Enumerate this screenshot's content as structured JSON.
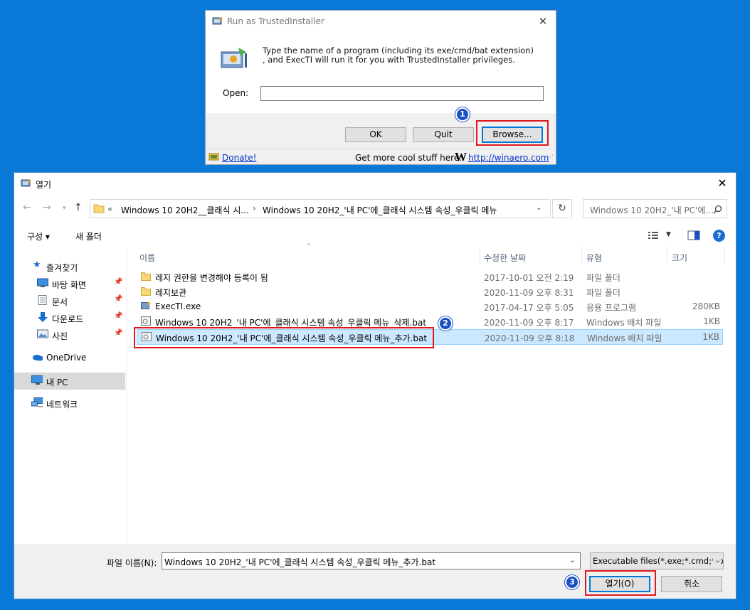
{
  "trusted_dialog": {
    "title": "Run as TrustedInstaller",
    "description_line1": "Type the name of a program (including its exe/cmd/bat extension)",
    "description_line2": ", and ExecTI will run it for you with TrustedInstaller privileges.",
    "open_label": "Open:",
    "open_value": "",
    "ok_label": "OK",
    "quit_label": "Quit",
    "browse_label": "Browse...",
    "donate_label": "Donate!",
    "more_stuff_label": "Get more cool stuff here:",
    "winaero_logo": "W",
    "winaero_link": "http://winaero.com"
  },
  "file_dialog": {
    "title": "열기",
    "breadcrumb": {
      "overflow": "«",
      "segment1": "Windows 10 20H2__클래식 시...",
      "separator": "›",
      "segment2": "Windows 10 20H2_'내 PC'에_클래식 시스템 속성_우클릭 메뉴"
    },
    "search_placeholder": "Windows 10 20H2_'내 PC'에...",
    "toolbar": {
      "organize": "구성 ▾",
      "new_folder": "새 폴더"
    },
    "sidebar": {
      "quick_access": "즐겨찾기",
      "desktop": "바탕 화면",
      "documents": "문서",
      "downloads": "다운로드",
      "pictures": "사진",
      "onedrive": "OneDrive",
      "this_pc": "내 PC",
      "network": "네트워크"
    },
    "columns": {
      "name": "이름",
      "modified": "수정한 날짜",
      "type": "유형",
      "size": "크기"
    },
    "files": [
      {
        "name": "레지 권한을 변경해야 등록이 됨",
        "modified": "2017-10-01 오전 2:19",
        "type": "파일 폴더",
        "size": "",
        "icon": "folder-icon"
      },
      {
        "name": "레지보관",
        "modified": "2020-11-09 오후 8:31",
        "type": "파일 폴더",
        "size": "",
        "icon": "folder-icon"
      },
      {
        "name": "ExecTI.exe",
        "modified": "2017-04-17 오후 5:05",
        "type": "응용 프로그램",
        "size": "280KB",
        "icon": "exe-icon"
      },
      {
        "name": "Windows 10 20H2_'내 PC'에_클래식 시스템 속성_우클릭 메뉴_삭제.bat",
        "modified": "2020-11-09 오후 8:17",
        "type": "Windows 배치 파일",
        "size": "1KB",
        "icon": "batch-file-icon"
      },
      {
        "name": "Windows 10 20H2_'내 PC'에_클래식 시스템 속성_우클릭 메뉴_추가.bat",
        "modified": "2020-11-09 오후 8:18",
        "type": "Windows 배치 파일",
        "size": "1KB",
        "icon": "batch-file-icon"
      }
    ],
    "filename_label": "파일 이름(N):",
    "filename_value": "Windows 10 20H2_'내 PC'에_클래식 시스템 속성_우클릭 메뉴_추가.bat",
    "filetype_value": "Executable files(*.exe;*.cmd;*.b",
    "open_button": "열기(O)",
    "cancel_button": "취소"
  },
  "badges": {
    "one": "1",
    "two": "2",
    "three": "3"
  },
  "colors": {
    "desktop": "#0a78d7",
    "highlight_red": "#e1171e",
    "badge_blue": "#1b4fc4",
    "selected_row": "#cce8ff",
    "focus_blue": "#0078d7"
  }
}
